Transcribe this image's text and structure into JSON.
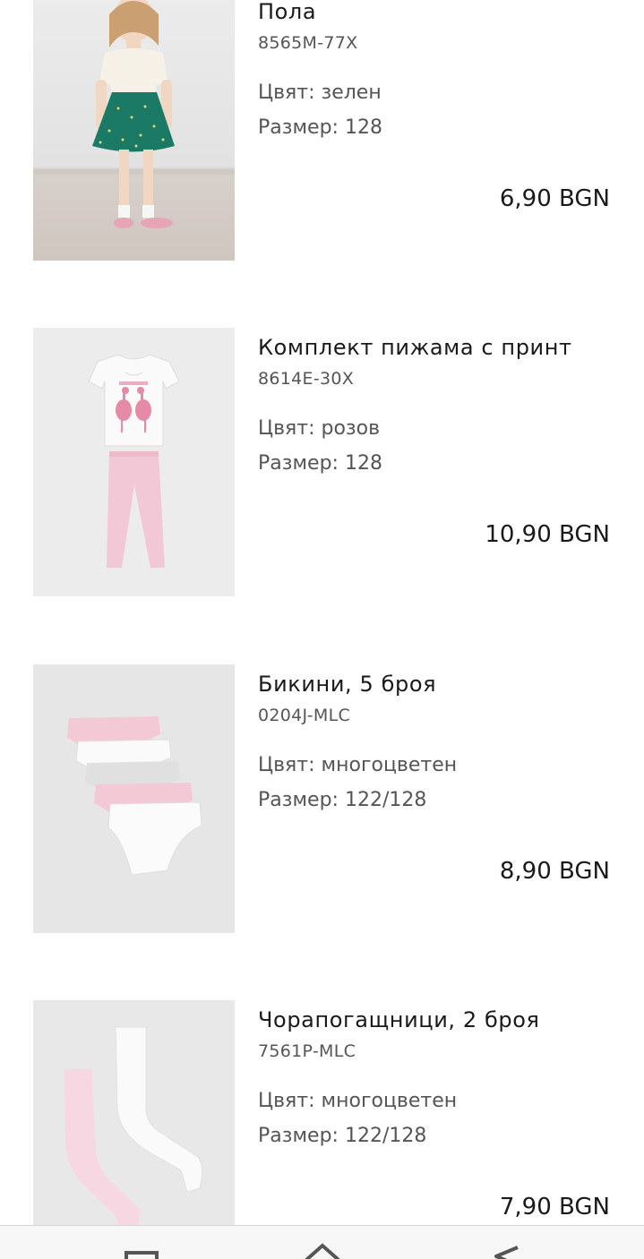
{
  "products": [
    {
      "title": "Пола",
      "sku": "8565M-77X",
      "color_label": "Цвят: зелен",
      "size_label": "Размер: 128",
      "price": "6,90 BGN",
      "image_icon": "skirt-product-photo"
    },
    {
      "title": "Комплект пижама с принт",
      "sku": "8614E-30X",
      "color_label": "Цвят: розов",
      "size_label": "Размер: 128",
      "price": "10,90 BGN",
      "image_icon": "pajama-product-photo"
    },
    {
      "title": "Бикини, 5 броя",
      "sku": "0204J-MLC",
      "color_label": "Цвят: многоцветен",
      "size_label": "Размер: 122/128",
      "price": "8,90 BGN",
      "image_icon": "underwear-product-photo"
    },
    {
      "title": "Чорапогащници, 2 броя",
      "sku": "7561P-MLC",
      "color_label": "Цвят: многоцветен",
      "size_label": "Размер: 122/128",
      "price": "7,90 BGN",
      "image_icon": "tights-product-photo"
    }
  ],
  "navbar": {
    "icons": [
      "recent-apps-icon",
      "home-icon",
      "back-icon"
    ]
  },
  "colors": {
    "text": "#1a1a1a",
    "secondary_text": "#555555",
    "thumb_bg": "#e8e8e8"
  }
}
